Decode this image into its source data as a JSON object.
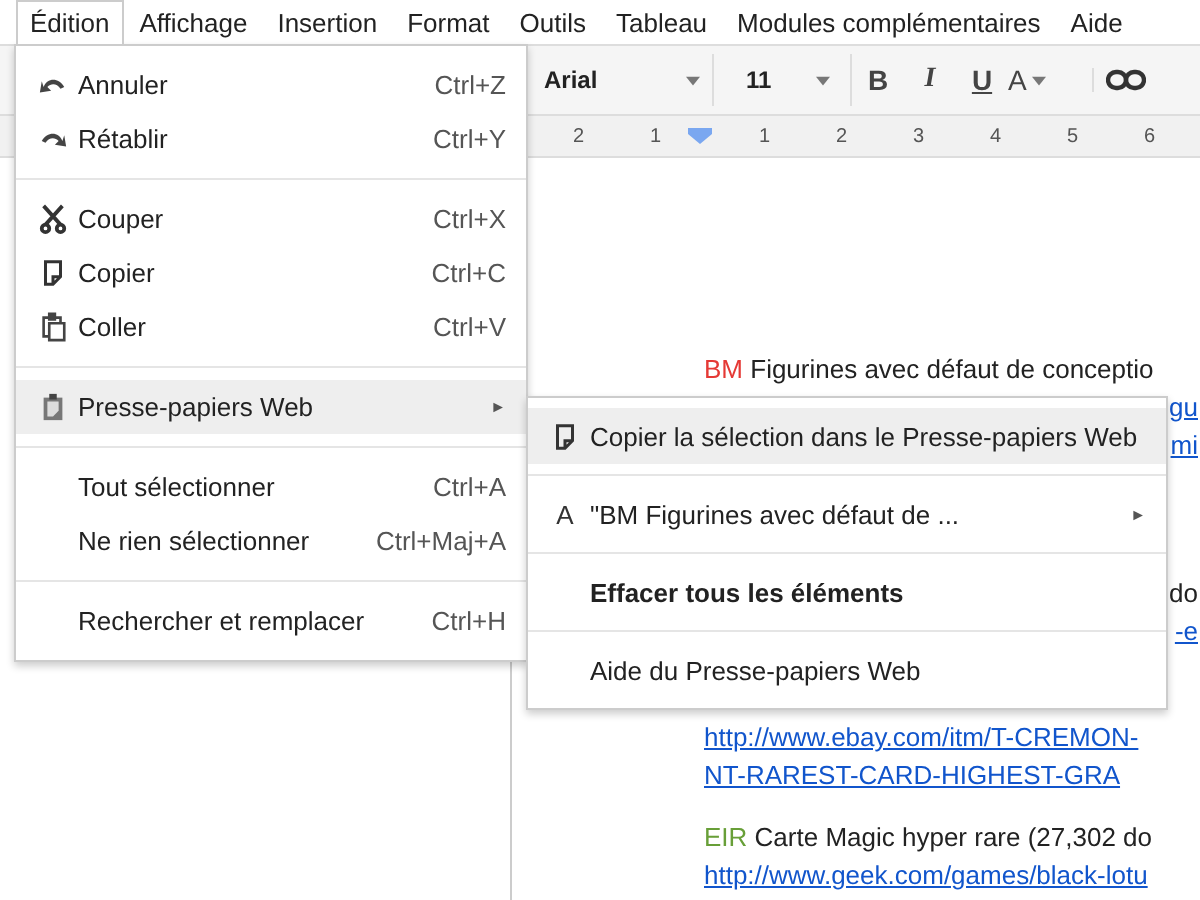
{
  "menubar": [
    {
      "label": "Édition",
      "selected": true
    },
    {
      "label": "Affichage",
      "selected": false
    },
    {
      "label": "Insertion",
      "selected": false
    },
    {
      "label": "Format",
      "selected": false
    },
    {
      "label": "Outils",
      "selected": false
    },
    {
      "label": "Tableau",
      "selected": false
    },
    {
      "label": "Modules complémentaires",
      "selected": false
    },
    {
      "label": "Aide",
      "selected": false
    }
  ],
  "toolbar": {
    "font": "Arial",
    "size": "11",
    "format_buttons": [
      "B",
      "I",
      "U",
      "A"
    ]
  },
  "ruler": [
    "2",
    "1",
    "1",
    "2",
    "3",
    "4",
    "5",
    "6"
  ],
  "edit_menu": [
    [
      {
        "label": "Annuler",
        "shortcut": "Ctrl+Z",
        "selected": false
      },
      {
        "label": "Rétablir",
        "shortcut": "Ctrl+Y",
        "selected": false
      }
    ],
    [
      {
        "label": "Couper",
        "shortcut": "Ctrl+X",
        "selected": false
      },
      {
        "label": "Copier",
        "shortcut": "Ctrl+C",
        "selected": false
      },
      {
        "label": "Coller",
        "shortcut": "Ctrl+V",
        "selected": false
      }
    ],
    [
      {
        "label": "Presse-papiers Web",
        "arrow": "►",
        "selected": true
      }
    ],
    [
      {
        "label": "Tout sélectionner",
        "shortcut": "Ctrl+A",
        "selected": false
      },
      {
        "label": "Ne rien sélectionner",
        "shortcut": "Ctrl+Maj+A",
        "selected": false
      }
    ],
    [
      {
        "label": "Rechercher et remplacer",
        "shortcut": "Ctrl+H",
        "selected": false
      }
    ]
  ],
  "submenu": [
    {
      "label": "Copier la sélection dans le Presse-papiers Web",
      "selected": true,
      "bold": false
    },
    {
      "glyph": "A",
      "label": "\"BM Figurines avec défaut de ...",
      "arrow": "►",
      "selected": false,
      "bold": false
    },
    {
      "label": "Effacer tous les éléments",
      "selected": false,
      "bold": true
    },
    {
      "label": "Aide du Presse-papiers Web",
      "selected": false,
      "bold": false
    }
  ],
  "document": [
    [
      {
        "kind": "entry",
        "tag": "BM",
        "color": "#e53935",
        "text": "Figurines avec défaut de conceptio"
      },
      {
        "kind": "fragment_link",
        "text": "gu"
      },
      {
        "kind": "fragment_link",
        "text": "mi"
      }
    ],
    [
      {
        "kind": "fragment",
        "text": "do"
      },
      {
        "kind": "fragment_link",
        "text": "-e"
      }
    ],
    [
      {
        "kind": "link",
        "text": "http://www.ebay.com/itm/T-CREMON-"
      },
      {
        "kind": "link",
        "text": "NT-RAREST-CARD-HIGHEST-GRA"
      }
    ],
    [
      {
        "kind": "entry",
        "tag": "EIR",
        "color": "#689f38",
        "text": "Carte Magic hyper rare (27,302 do"
      },
      {
        "kind": "link",
        "text": "http://www.geek.com/games/black-lotu"
      }
    ]
  ]
}
